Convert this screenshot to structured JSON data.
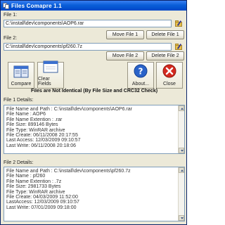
{
  "window": {
    "title": "Files Comapre 1.1"
  },
  "file1": {
    "label": "File 1:",
    "path": "C:\\install\\dev\\components\\AOP6.rar",
    "move_label": "Move File 1",
    "delete_label": "Delete File 1"
  },
  "file2": {
    "label": "File 2:",
    "path": "C:\\install\\dev\\components\\pf260.7z",
    "move_label": "Move File 2",
    "delete_label": "Delete File 2"
  },
  "toolbar": {
    "compare_label": "Compare",
    "clear_label": "Clear Fields",
    "about_label": "About...",
    "close_label": "Close"
  },
  "status": "Files are Not Identical (By File Size and CRC32 Check)",
  "details1": {
    "label": "File 1 Details:",
    "lines": [
      "File Name and Path : C:\\install\\dev\\components\\AOP6.rar",
      "File Name : AOP6",
      "File Name Extention : .rar",
      "File Size: 899146 Bytes",
      "File Type: WinRAR archive",
      "File Create: 06/11/2008 20:17:55",
      "Last Access: 12/03/2009 09:10:57",
      "Last Write: 06/11/2008 20:18:06"
    ]
  },
  "details2": {
    "label": "File 2 Details:",
    "lines": [
      "File Name and Path : C:\\install\\dev\\components\\pf260.7z",
      "File Name : pf260",
      "File Name Extention : .7z",
      "File Size: 2981733 Bytes",
      "File Type: WinRAR archive",
      "File Create: 04/03/2009 11:52:00",
      "LastAccess: 12/03/2009 09:10:57",
      "Last Write: 07/01/2009 09:18:00"
    ]
  },
  "colors": {
    "titlebar": "#0a5fd8",
    "window_bg": "#ece9d8",
    "field_border": "#7f9db9",
    "close_red": "#d4291f",
    "about_blue": "#2a63c9"
  },
  "icons": {
    "app": "app-icon",
    "browse": "folder-icon",
    "compare": "compare-icon",
    "clear": "clear-icon",
    "about": "help-icon",
    "close": "close-icon"
  }
}
